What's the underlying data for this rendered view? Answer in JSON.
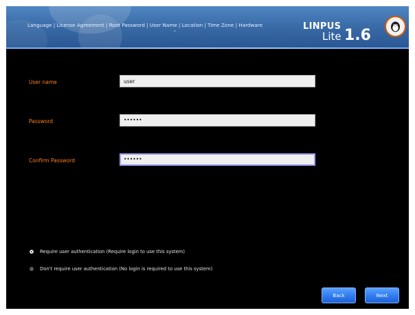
{
  "header": {
    "breadcrumb": "Language | License Agreement | Root Password | User Name | Location | Time Zone | Hardware",
    "caret": "^",
    "logo": {
      "brand": "LINPUS",
      "lite": "Lite",
      "version": "1.6"
    }
  },
  "form": {
    "username": {
      "label": "User name",
      "value": "user"
    },
    "password": {
      "label": "Password",
      "value": "••••••"
    },
    "confirm": {
      "label": "Confirm Password",
      "value": "••••••"
    }
  },
  "auth": {
    "require_label": "Require user authentication (Require login to use this system)",
    "no_require_label": "Don't require user authentication (No login is required to use this system)",
    "selected": "require"
  },
  "buttons": {
    "back": "Back",
    "next": "Next"
  },
  "colors": {
    "label": "#ff7f1f",
    "accent": "#2f7bef",
    "background": "#000000"
  }
}
